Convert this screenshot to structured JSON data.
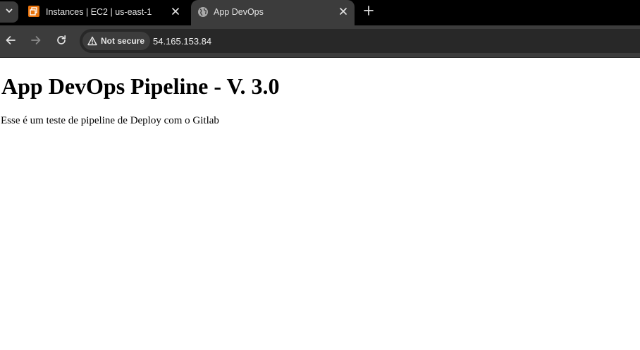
{
  "browser": {
    "tabs": [
      {
        "title": "Instances | EC2 | us-east-1",
        "favicon": "aws-ec2-icon",
        "active": false,
        "favicon_color": "#e8730c"
      },
      {
        "title": "App DevOps",
        "favicon": "globe-icon",
        "active": true
      }
    ],
    "toolbar": {
      "security_label": "Not secure",
      "url": "54.165.153.84"
    },
    "colors": {
      "tabstrip_bg": "#000000",
      "toolbar_bg": "#3c3c3c",
      "omnibox_bg": "#282828",
      "text": "#e3e3e3"
    }
  },
  "page": {
    "heading": "App DevOps Pipeline - V. 3.0",
    "paragraph": "Esse é um teste de pipeline de Deploy com o Gitlab"
  }
}
